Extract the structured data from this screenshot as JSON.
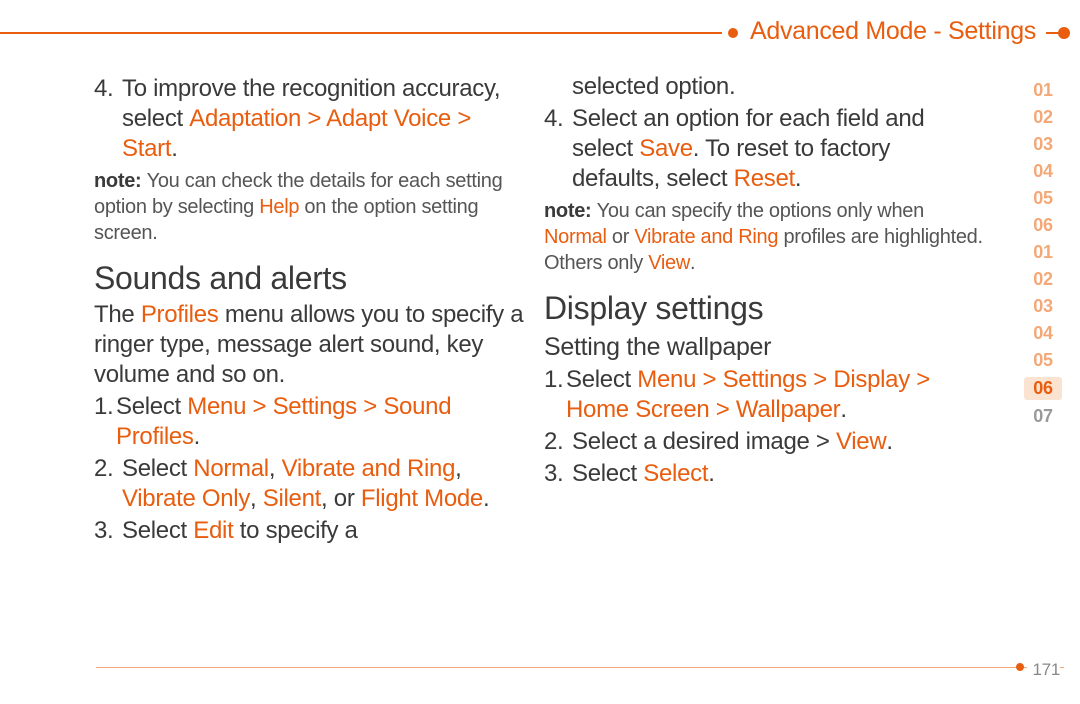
{
  "header": {
    "title": "Advanced Mode - Settings"
  },
  "col1": {
    "step4_num": "4.",
    "step4_a": "To improve the recognition accuracy, select ",
    "step4_b": "Adaptation > Adapt Voice > Start",
    "step4_c": ".",
    "note_label": "note: ",
    "note_a": "You can check the details for each setting option by selecting ",
    "note_b": "Help",
    "note_c": " on the option setting screen.",
    "h1": "Sounds and alerts",
    "intro_a": "The ",
    "intro_b": "Profiles",
    "intro_c": " menu allows you to specify a ringer type, message alert sound, key volume and so on.",
    "s1_num": "1.",
    "s1_a": "Select ",
    "s1_b": "Menu > Settings > Sound Profiles",
    "s1_c": ".",
    "s2_num": "2.",
    "s2_a": "Select ",
    "s2_b": "Normal",
    "s2_c": ", ",
    "s2_d": "Vibrate and Ring",
    "s2_e": ", ",
    "s2_f": "Vibrate Only",
    "s2_g": ", ",
    "s2_h": "Silent",
    "s2_i": ", or ",
    "s2_j": "Flight Mode",
    "s2_k": ".",
    "s3_num": "3.",
    "s3_a": "Select ",
    "s3_b": "Edit",
    "s3_c": " to specify a"
  },
  "col2": {
    "cont": "selected option.",
    "s4_num": "4.",
    "s4_a": "Select an option for each field and select ",
    "s4_b": "Save",
    "s4_c": ". To reset to factory defaults, select ",
    "s4_d": "Reset",
    "s4_e": ".",
    "note_label": "note: ",
    "note_a": "You can specify the options only when ",
    "note_b": "Normal",
    "note_c": " or ",
    "note_d": "Vibrate and Ring",
    "note_e": " profiles are highlighted. Others only ",
    "note_f": "View",
    "note_g": ".",
    "h1": "Display settings",
    "h2": "Setting the wallpaper",
    "d1_num": "1.",
    "d1_a": "Select ",
    "d1_b": "Menu > Settings > Display > Home Screen > Wallpaper",
    "d1_c": ".",
    "d2_num": "2.",
    "d2_a": "Select a desired image > ",
    "d2_b": "View",
    "d2_c": ".",
    "d3_num": "3.",
    "d3_a": "Select ",
    "d3_b": "Select",
    "d3_c": "."
  },
  "side": {
    "g1": [
      "01",
      "02",
      "03",
      "04",
      "05",
      "06"
    ],
    "g2": [
      "01",
      "02",
      "03",
      "04",
      "05"
    ],
    "active": "06",
    "after": "07"
  },
  "footer": {
    "page": "171"
  }
}
